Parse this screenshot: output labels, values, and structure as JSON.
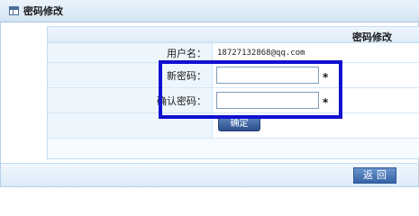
{
  "window": {
    "title": "密码修改",
    "icon": "window-icon"
  },
  "form": {
    "header": "密码修改",
    "rows": [
      {
        "label": "用户名：",
        "value": "18727132868@qq.com"
      },
      {
        "label": "新密码：",
        "value": "",
        "required_mark": "*"
      },
      {
        "label": "确认密码：",
        "value": "",
        "required_mark": "*"
      }
    ],
    "confirm_button": "确定"
  },
  "footer": {
    "back_button": "返回"
  },
  "colors": {
    "highlight_border": "#1010d0",
    "button_blue": "#2c4f8c"
  }
}
